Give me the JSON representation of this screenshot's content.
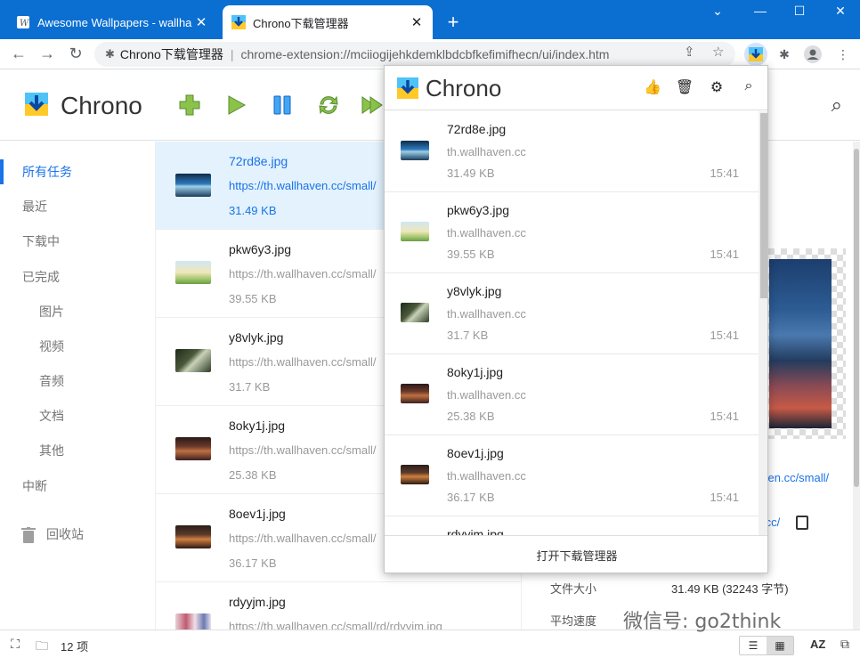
{
  "browser": {
    "tabs": [
      {
        "title": "Awesome Wallpapers - wallha",
        "active": false
      },
      {
        "title": "Chrono下载管理器",
        "active": true
      }
    ],
    "omnibox": {
      "ext_name": "Chrono下载管理器",
      "url": "chrome-extension://mciiogijehkdemklbdcbfkefimifhecn/ui/index.htm"
    }
  },
  "app": {
    "title": "Chrono",
    "actions": [
      "add-icon",
      "play-icon",
      "pause-icon",
      "refresh-icon",
      "play-all-icon"
    ]
  },
  "sidebar": {
    "items": [
      {
        "label": "所有任务",
        "selected": true
      },
      {
        "label": "最近"
      },
      {
        "label": "下载中"
      },
      {
        "label": "已完成"
      },
      {
        "label": "图片"
      },
      {
        "label": "视频"
      },
      {
        "label": "音频"
      },
      {
        "label": "文档"
      },
      {
        "label": "其他"
      },
      {
        "label": "中断"
      },
      {
        "label": "回收站"
      }
    ]
  },
  "downloads": [
    {
      "name": "72rd8e.jpg",
      "url": "https://th.wallhaven.cc/small/",
      "size": "31.49 KB"
    },
    {
      "name": "pkw6y3.jpg",
      "url": "https://th.wallhaven.cc/small/",
      "size": "39.55 KB"
    },
    {
      "name": "y8vlyk.jpg",
      "url": "https://th.wallhaven.cc/small/",
      "size": "31.7 KB"
    },
    {
      "name": "8oky1j.jpg",
      "url": "https://th.wallhaven.cc/small/",
      "size": "25.38 KB"
    },
    {
      "name": "8oev1j.jpg",
      "url": "https://th.wallhaven.cc/small/",
      "size": "36.17 KB"
    },
    {
      "name": "rdyyjm.jpg",
      "url": "https://th.wallhaven.cc/small/rd/rdyyjm.jpg",
      "size": ""
    }
  ],
  "detail": {
    "link1": "ven.cc/small/",
    "link2": ".cc/",
    "file_size_label": "文件大小",
    "file_size_value": "31.49 KB (32243 字节)",
    "avg_speed_label": "平均速度"
  },
  "status": {
    "count": "12 项",
    "sort": "AZ"
  },
  "popup": {
    "title": "Chrono",
    "items": [
      {
        "name": "72rd8e.jpg",
        "host": "th.wallhaven.cc",
        "size": "31.49 KB",
        "time": "15:41"
      },
      {
        "name": "pkw6y3.jpg",
        "host": "th.wallhaven.cc",
        "size": "39.55 KB",
        "time": "15:41"
      },
      {
        "name": "y8vlyk.jpg",
        "host": "th.wallhaven.cc",
        "size": "31.7 KB",
        "time": "15:41"
      },
      {
        "name": "8oky1j.jpg",
        "host": "th.wallhaven.cc",
        "size": "25.38 KB",
        "time": "15:41"
      },
      {
        "name": "8oev1j.jpg",
        "host": "th.wallhaven.cc",
        "size": "36.17 KB",
        "time": "15:41"
      },
      {
        "name": "rdyyjm.jpg",
        "host": "",
        "size": "",
        "time": ""
      }
    ],
    "footer": "打开下载管理器"
  },
  "watermark": "微信号: go2think",
  "colors": {
    "tabstrip": "#0b6fd1",
    "accent": "#1a73e8",
    "selected_row": "#e3f2fd"
  }
}
